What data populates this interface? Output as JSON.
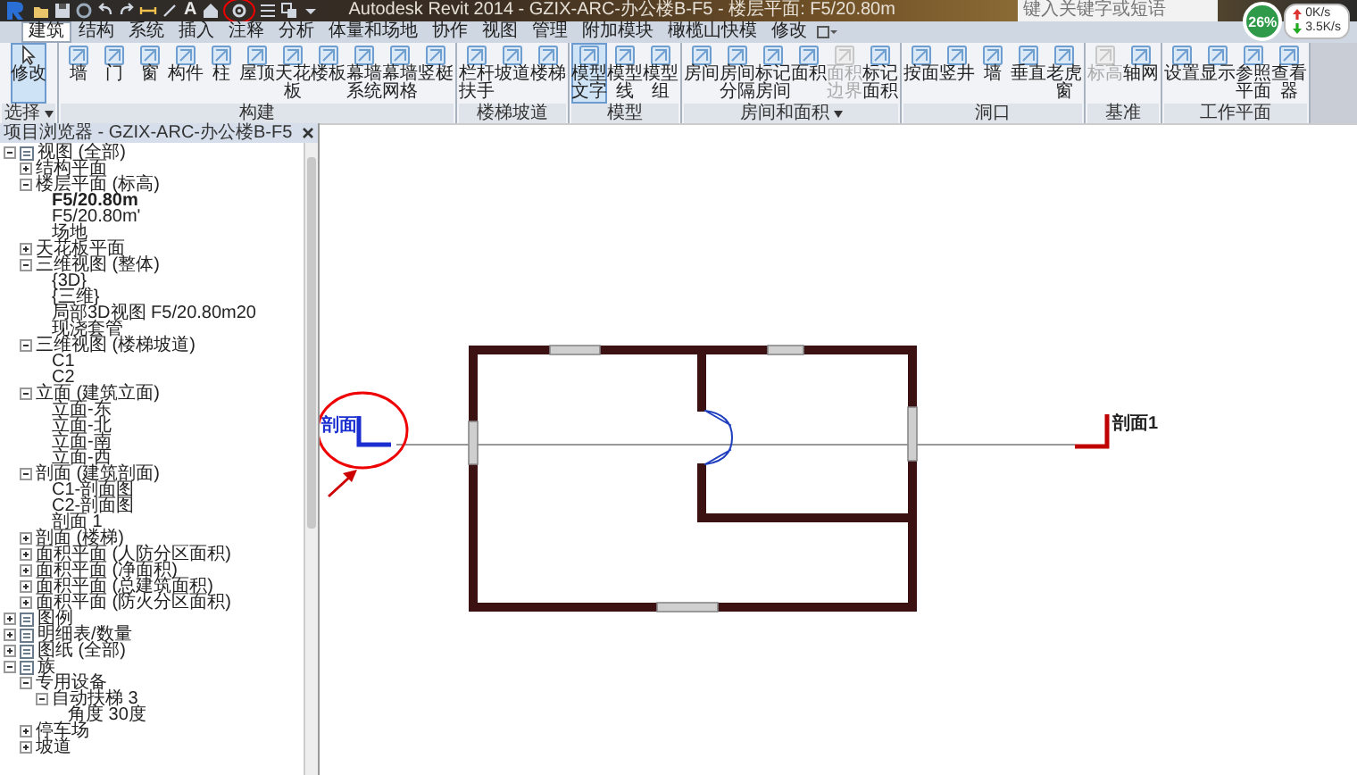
{
  "title_bar": {
    "text_tool": "A",
    "title": "Autodesk Revit 2014 - GZIX-ARC-办公楼B-F5 - 楼层平面: F5/20.80m",
    "search": {
      "placeholder": "键入关键字或短语"
    }
  },
  "network_widget": {
    "usage": "26%",
    "upload": "0K/s",
    "download": "3.5K/s"
  },
  "tabs": [
    {
      "label": "建筑",
      "selected": true
    },
    {
      "label": "结构",
      "selected": false
    },
    {
      "label": "系统",
      "selected": false
    },
    {
      "label": "插入",
      "selected": false
    },
    {
      "label": "注释",
      "selected": false
    },
    {
      "label": "分析",
      "selected": false
    },
    {
      "label": "体量和场地",
      "selected": false
    },
    {
      "label": "协作",
      "selected": false
    },
    {
      "label": "视图",
      "selected": false
    },
    {
      "label": "管理",
      "selected": false
    },
    {
      "label": "附加模块",
      "selected": false
    },
    {
      "label": "橄榄山快模",
      "selected": false
    },
    {
      "label": "修改",
      "selected": false
    }
  ],
  "ribbon": [
    {
      "label": "选择",
      "menu": true,
      "tools": [
        {
          "label": "修改",
          "selected": true,
          "disabled": false
        }
      ]
    },
    {
      "label": "构建",
      "tools": [
        {
          "label": "墙",
          "selected": false,
          "disabled": false
        },
        {
          "label": "门",
          "selected": false,
          "disabled": false
        },
        {
          "label": "窗",
          "selected": false,
          "disabled": false
        },
        {
          "label": "构件",
          "selected": false,
          "disabled": false
        },
        {
          "label": "柱",
          "selected": false,
          "disabled": false
        },
        {
          "label": "屋顶",
          "selected": false,
          "disabled": false
        },
        {
          "label": "天花板",
          "selected": false,
          "disabled": false
        },
        {
          "label": "楼板",
          "selected": false,
          "disabled": false
        },
        {
          "label": "幕墙系统",
          "selected": false,
          "disabled": false
        },
        {
          "label": "幕墙网格",
          "selected": false,
          "disabled": false
        },
        {
          "label": "竖梃",
          "selected": false,
          "disabled": false
        }
      ]
    },
    {
      "label": "楼梯坡道",
      "tools": [
        {
          "label": "栏杆扶手",
          "selected": false,
          "disabled": false
        },
        {
          "label": "坡道",
          "selected": false,
          "disabled": false
        },
        {
          "label": "楼梯",
          "selected": false,
          "disabled": false
        }
      ]
    },
    {
      "label": "模型",
      "tools": [
        {
          "label": "模型文字",
          "selected": true,
          "disabled": false
        },
        {
          "label": "模型线",
          "selected": false,
          "disabled": false
        },
        {
          "label": "模型组",
          "selected": false,
          "disabled": false
        }
      ]
    },
    {
      "label": "房间和面积",
      "menu": true,
      "tools": [
        {
          "label": "房间",
          "selected": false,
          "disabled": false
        },
        {
          "label": "房间分隔",
          "selected": false,
          "disabled": false
        },
        {
          "label": "标记房间",
          "selected": false,
          "disabled": false
        },
        {
          "label": "面积",
          "selected": false,
          "disabled": false
        },
        {
          "label": "面积边界",
          "selected": false,
          "disabled": true
        },
        {
          "label": "标记面积",
          "selected": false,
          "disabled": false
        }
      ]
    },
    {
      "label": "洞口",
      "tools": [
        {
          "label": "按面",
          "selected": false,
          "disabled": false
        },
        {
          "label": "竖井",
          "selected": false,
          "disabled": false
        },
        {
          "label": "墙",
          "selected": false,
          "disabled": false
        },
        {
          "label": "垂直",
          "selected": false,
          "disabled": false
        },
        {
          "label": "老虎窗",
          "selected": false,
          "disabled": false
        }
      ]
    },
    {
      "label": "基准",
      "tools": [
        {
          "label": "标高",
          "selected": false,
          "disabled": true
        },
        {
          "label": "轴网",
          "selected": false,
          "disabled": false
        }
      ]
    },
    {
      "label": "工作平面",
      "tools": [
        {
          "label": "设置",
          "selected": false,
          "disabled": false
        },
        {
          "label": "显示",
          "selected": false,
          "disabled": false
        },
        {
          "label": "参照平面",
          "selected": false,
          "disabled": false
        },
        {
          "label": "查看器",
          "selected": false,
          "disabled": false
        }
      ]
    }
  ],
  "project_browser": {
    "title": "项目浏览器 - GZIX-ARC-办公楼B-F5",
    "tree": [
      {
        "label": "视图 (全部)",
        "expanded": true,
        "selected": false,
        "children": [
          {
            "label": "结构平面",
            "expanded": false,
            "selected": false
          },
          {
            "label": "楼层平面 (标高)",
            "expanded": true,
            "selected": false,
            "children": [
              {
                "label": "F5/20.80m",
                "selected": true
              },
              {
                "label": "F5/20.80m'",
                "selected": false
              },
              {
                "label": "场地",
                "selected": false
              }
            ]
          },
          {
            "label": "天花板平面",
            "expanded": false,
            "selected": false
          },
          {
            "label": "三维视图 (整体)",
            "expanded": true,
            "selected": false,
            "children": [
              {
                "label": "{3D}",
                "selected": false
              },
              {
                "label": "{三维}",
                "selected": false
              },
              {
                "label": "局部3D视图 F5/20.80m20",
                "selected": false
              },
              {
                "label": "现浇套管",
                "selected": false
              }
            ]
          },
          {
            "label": "三维视图 (楼梯坡道)",
            "expanded": true,
            "selected": false,
            "children": [
              {
                "label": "C1",
                "selected": false
              },
              {
                "label": "C2",
                "selected": false
              }
            ]
          },
          {
            "label": "立面 (建筑立面)",
            "expanded": true,
            "selected": false,
            "children": [
              {
                "label": "立面-东",
                "selected": false
              },
              {
                "label": "立面-北",
                "selected": false
              },
              {
                "label": "立面-南",
                "selected": false
              },
              {
                "label": "立面-西",
                "selected": false
              }
            ]
          },
          {
            "label": "剖面 (建筑剖面)",
            "expanded": true,
            "selected": false,
            "children": [
              {
                "label": "C1-剖面图",
                "selected": false
              },
              {
                "label": "C2-剖面图",
                "selected": false
              },
              {
                "label": "剖面 1",
                "selected": false
              }
            ]
          },
          {
            "label": "剖面 (楼梯)",
            "expanded": false,
            "selected": false
          },
          {
            "label": "面积平面 (人防分区面积)",
            "expanded": false,
            "selected": false
          },
          {
            "label": "面积平面 (净面积)",
            "expanded": false,
            "selected": false
          },
          {
            "label": "面积平面 (总建筑面积)",
            "expanded": false,
            "selected": false
          },
          {
            "label": "面积平面 (防火分区面积)",
            "expanded": false,
            "selected": false
          }
        ]
      },
      {
        "label": "图例",
        "expanded": false,
        "selected": false
      },
      {
        "label": "明细表/数量",
        "expanded": false,
        "selected": false
      },
      {
        "label": "图纸 (全部)",
        "expanded": false,
        "selected": false
      },
      {
        "label": "族",
        "expanded": true,
        "selected": false,
        "children": [
          {
            "label": "专用设备",
            "expanded": true,
            "selected": false,
            "children": [
              {
                "label": "自动扶梯 3",
                "expanded": true,
                "selected": false,
                "children": [
                  {
                    "label": "角度 30度",
                    "selected": false
                  }
                ]
              }
            ]
          },
          {
            "label": "停车场",
            "expanded": false,
            "selected": false
          },
          {
            "label": "坡道",
            "expanded": false,
            "selected": false
          }
        ]
      }
    ]
  },
  "canvas": {
    "section_left": "剖面",
    "section_right": "剖面1"
  }
}
